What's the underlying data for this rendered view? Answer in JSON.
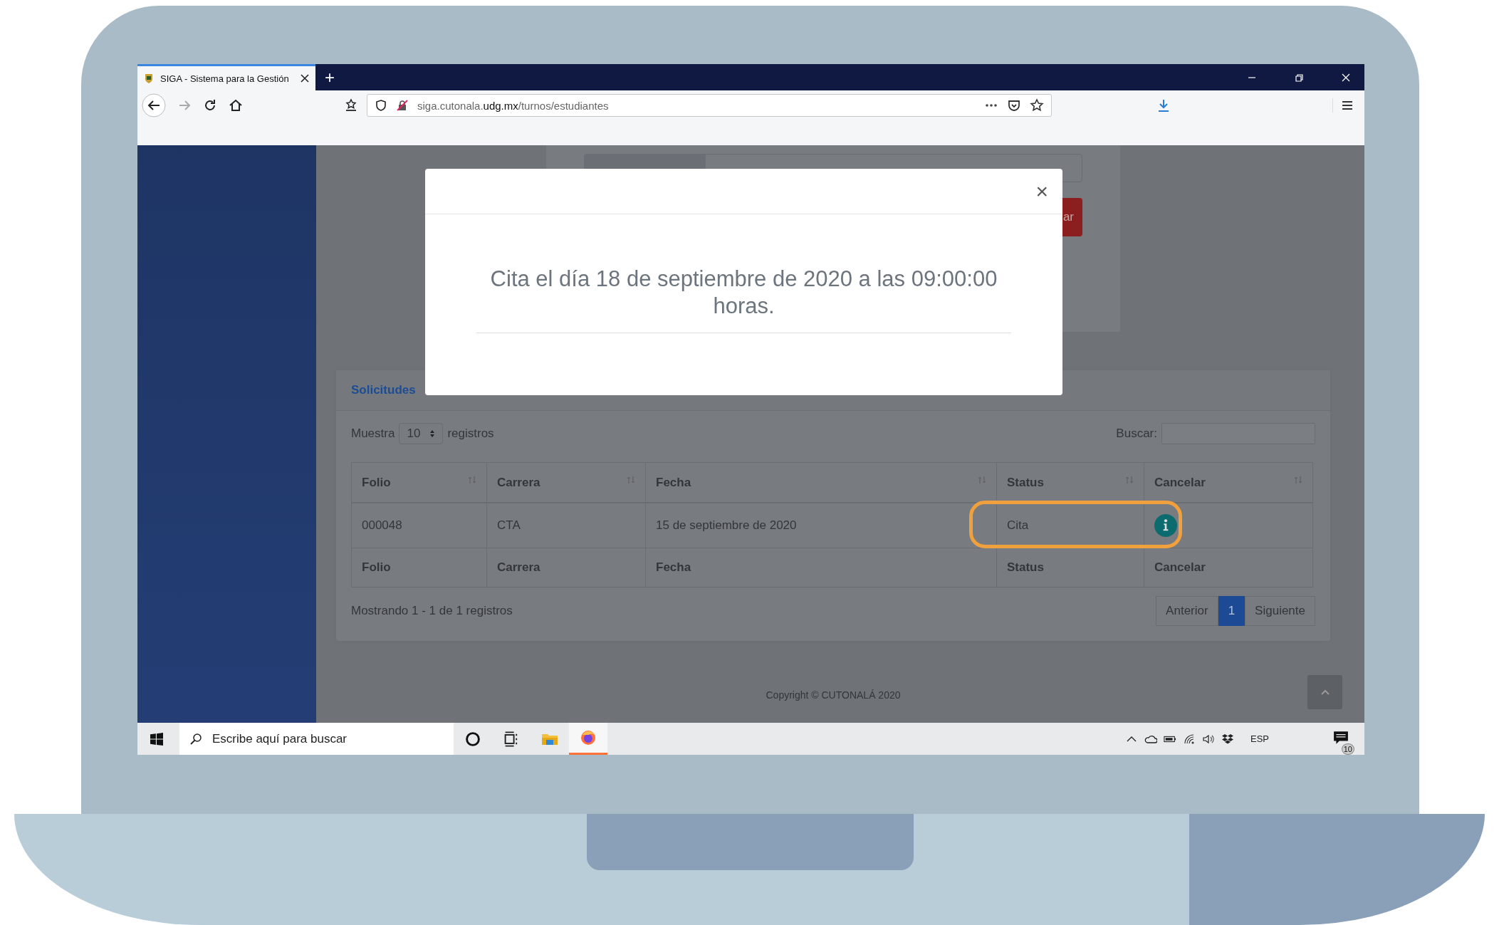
{
  "browser": {
    "tab": {
      "title": "SIGA - Sistema para la Gestión"
    },
    "new_tab": "+",
    "url": {
      "host": "siga.cutonala.",
      "domain": "udg.mx",
      "path": "/turnos/estudiantes"
    }
  },
  "page": {
    "filter_card": {
      "button_fragment": "ar"
    },
    "solicitudes": {
      "title": "Solicitudes",
      "length_before": "Muestra",
      "length_value": "10",
      "length_after": "registros",
      "search_label": "Buscar:",
      "columns": [
        "Folio",
        "Carrera",
        "Fecha",
        "Status",
        "Cancelar"
      ],
      "rows": [
        {
          "folio": "000048",
          "carrera": "CTA",
          "fecha": "15 de septiembre de 2020",
          "status": "Cita",
          "highlighted": true
        }
      ],
      "footer_columns": [
        "Folio",
        "Carrera",
        "Fecha",
        "Status",
        "Cancelar"
      ],
      "info": "Mostrando 1 - 1 de 1 registros",
      "pagination": [
        {
          "label": "Anterior",
          "selected": false
        },
        {
          "label": "1",
          "selected": true
        },
        {
          "label": "Siguiente",
          "selected": false
        }
      ]
    },
    "copyright": "Copyright © CUTONALÁ 2020"
  },
  "modal": {
    "close": "×",
    "message": "Cita el día 18 de septiembre de 2020 a las 09:00:00 horas."
  },
  "taskbar": {
    "search_placeholder": "Escribe aquí para buscar",
    "language": "ESP",
    "notification_count": "10"
  }
}
